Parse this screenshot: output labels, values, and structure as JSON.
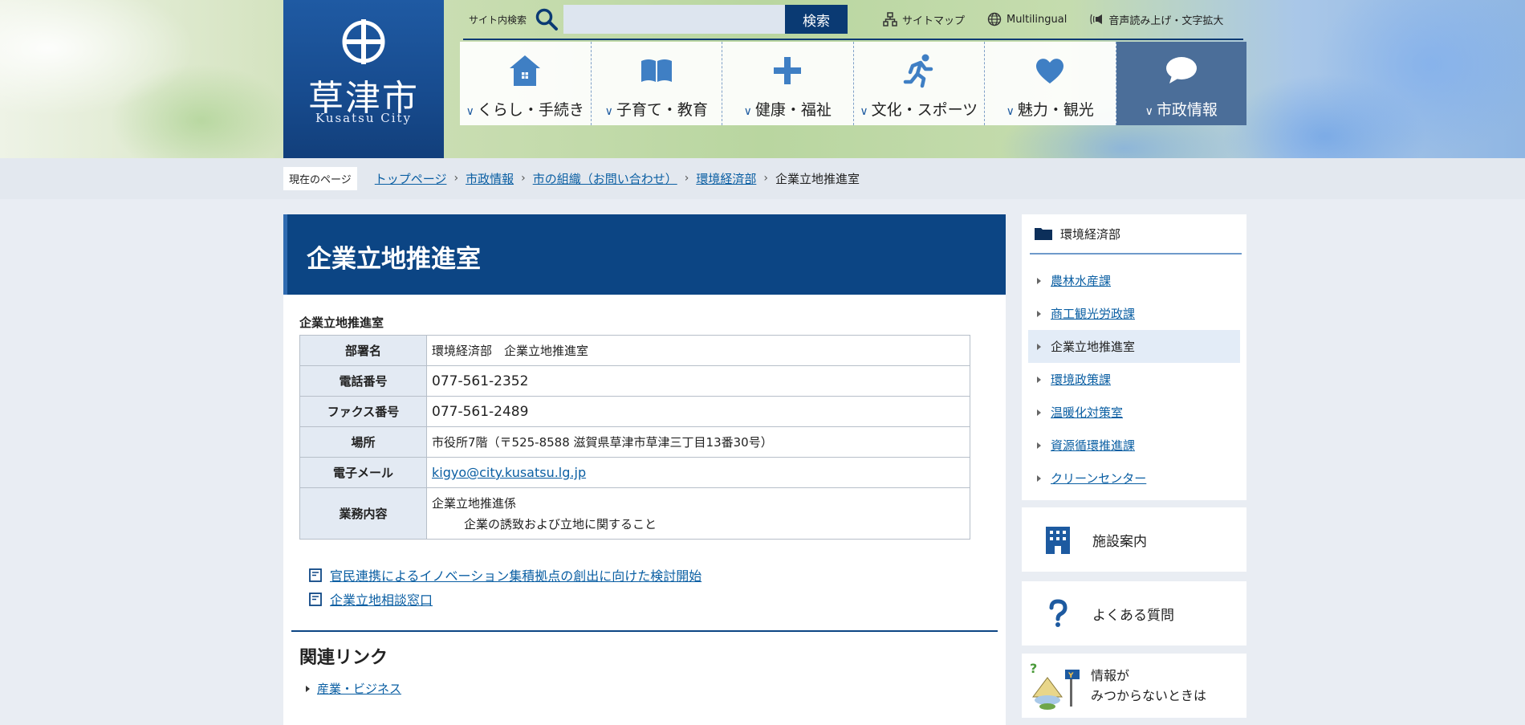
{
  "site": {
    "name": "草津市",
    "name_en": "Kusatsu City"
  },
  "utility": {
    "search_label": "サイト内検索",
    "search_placeholder": "",
    "search_button": "検索",
    "links": [
      {
        "icon": "sitemap-icon",
        "label": "サイトマップ"
      },
      {
        "icon": "globe-icon",
        "label": "Multilingual"
      },
      {
        "icon": "speaker-icon",
        "label": "音声読み上げ・文字拡大"
      }
    ]
  },
  "global_nav": [
    {
      "icon": "house-icon",
      "label": "くらし・手続き",
      "active": false
    },
    {
      "icon": "book-icon",
      "label": "子育て・教育",
      "active": false
    },
    {
      "icon": "plus-icon",
      "label": "健康・福祉",
      "active": false
    },
    {
      "icon": "runner-icon",
      "label": "文化・スポーツ",
      "active": false
    },
    {
      "icon": "heart-icon",
      "label": "魅力・観光",
      "active": false
    },
    {
      "icon": "speech-bubble-icon",
      "label": "市政情報",
      "active": true
    }
  ],
  "breadcrumb": {
    "label": "現在のページ",
    "items": [
      "トップページ",
      "市政情報",
      "市の組織（お問い合わせ）",
      "環境経済部"
    ],
    "current": "企業立地推進室"
  },
  "page": {
    "title": "企業立地推進室",
    "caption": "企業立地推進室",
    "info_table": {
      "dept_label": "部署名",
      "dept_value": "環境経済部　企業立地推進室",
      "tel_label": "電話番号",
      "tel_value": "077-561-2352",
      "fax_label": "ファクス番号",
      "fax_value": "077-561-2489",
      "place_label": "場所",
      "place_value": "市役所7階（〒525-8588 滋賀県草津市草津三丁目13番30号）",
      "email_label": "電子メール",
      "email_value": "kigyo@city.kusatsu.lg.jp",
      "duty_label": "業務内容",
      "duty_line1": "企業立地推進係",
      "duty_line2": "企業の誘致および立地に関すること"
    },
    "doc_links": [
      "官民連携によるイノベーション集積拠点の創出に向けた検討開始",
      "企業立地相談窓口"
    ],
    "related_heading": "関連リンク",
    "related_links": [
      "産業・ビジネス"
    ]
  },
  "sidebar": {
    "heading": "環境経済部",
    "items": [
      {
        "label": "農林水産課",
        "current": false
      },
      {
        "label": "商工観光労政課",
        "current": false
      },
      {
        "label": "企業立地推進室",
        "current": true
      },
      {
        "label": "環境政策課",
        "current": false
      },
      {
        "label": "温暖化対策室",
        "current": false
      },
      {
        "label": "資源循環推進課",
        "current": false
      },
      {
        "label": "クリーンセンター",
        "current": false
      }
    ],
    "facility_label": "施設案内",
    "faq_label": "よくある質問",
    "notfound_line1": "情報が",
    "notfound_line2": "みつからないときは"
  },
  "colors": {
    "brand_navy": "#0c4584",
    "link": "#0b5fa3",
    "nav_active": "#4b6e99",
    "icon_blue": "#3f7fc4"
  }
}
